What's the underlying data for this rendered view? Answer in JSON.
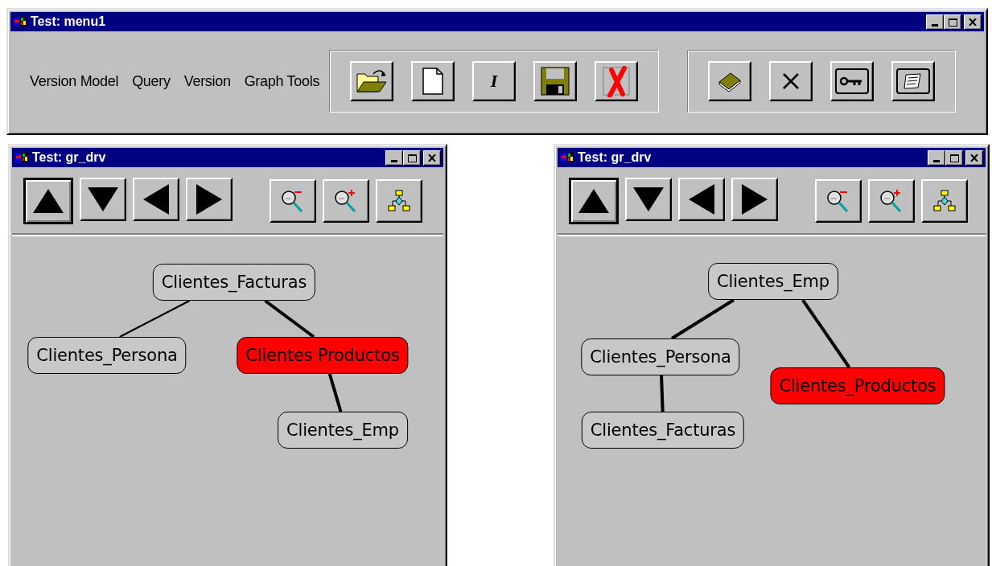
{
  "window": {
    "title": "Test: menu1"
  },
  "menu": [
    "Version Model",
    "Query",
    "Version",
    "Graph Tools"
  ],
  "toolbar_groups": [
    [
      {
        "kind": "open-folder"
      },
      {
        "kind": "new-document"
      },
      {
        "kind": "italic",
        "label": "I"
      },
      {
        "kind": "save"
      },
      {
        "kind": "delete"
      }
    ],
    [
      {
        "kind": "book"
      },
      {
        "kind": "close"
      },
      {
        "kind": "key"
      },
      {
        "kind": "scroll"
      }
    ]
  ],
  "graph_windows": [
    {
      "title": "Test: gr_drv",
      "nav_buttons": [
        {
          "kind": "up",
          "selected": true
        },
        {
          "kind": "down",
          "selected": false
        },
        {
          "kind": "left",
          "selected": false
        },
        {
          "kind": "right",
          "selected": false
        }
      ],
      "tool_buttons": [
        {
          "kind": "zoom-out"
        },
        {
          "kind": "zoom-in"
        },
        {
          "kind": "tree"
        }
      ],
      "tree": {
        "label": "Clientes_Facturas",
        "highlighted": false,
        "children": [
          {
            "label": "Clientes_Persona",
            "highlighted": false,
            "bold_edge": false
          },
          {
            "label": "Clientes Productos",
            "highlighted": true,
            "bold_edge": true,
            "children": [
              {
                "label": "Clientes_Emp",
                "highlighted": false,
                "bold_edge": true
              }
            ]
          }
        ]
      }
    },
    {
      "title": "Test: gr_drv",
      "nav_buttons": [
        {
          "kind": "up",
          "selected": true
        },
        {
          "kind": "down",
          "selected": false
        },
        {
          "kind": "left",
          "selected": false
        },
        {
          "kind": "right",
          "selected": false
        }
      ],
      "tool_buttons": [
        {
          "kind": "zoom-out"
        },
        {
          "kind": "zoom-in"
        },
        {
          "kind": "tree"
        }
      ],
      "tree": {
        "label": "Clientes_Emp",
        "highlighted": false,
        "children": [
          {
            "label": "Clientes_Persona",
            "highlighted": false,
            "bold_edge": true,
            "children": [
              {
                "label": "Clientes_Facturas",
                "highlighted": false,
                "bold_edge": true
              }
            ]
          },
          {
            "label": "Clientes_Productos",
            "highlighted": true,
            "bold_edge": true
          }
        ]
      }
    }
  ]
}
